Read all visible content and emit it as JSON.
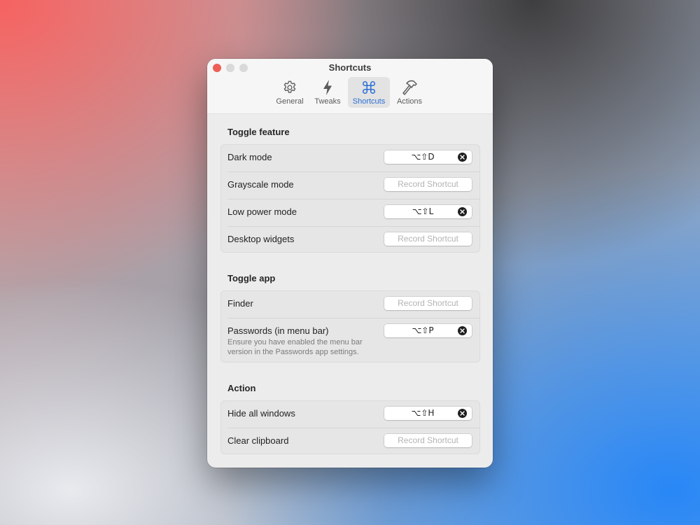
{
  "window": {
    "title": "Shortcuts"
  },
  "tabs": [
    {
      "label": "General",
      "icon": "gear-icon",
      "active": false
    },
    {
      "label": "Tweaks",
      "icon": "bolt-icon",
      "active": true
    },
    {
      "label": "Shortcuts",
      "icon": "command-icon",
      "active": true
    },
    {
      "label": "Actions",
      "icon": "hammer-icon",
      "active": false
    }
  ],
  "sections": [
    {
      "title": "Toggle feature",
      "rows": [
        {
          "label": "Dark mode",
          "shortcut": "⌥⇧D",
          "placeholder": "Record Shortcut"
        },
        {
          "label": "Grayscale mode",
          "shortcut": "",
          "placeholder": "Record Shortcut"
        },
        {
          "label": "Low power mode",
          "shortcut": "⌥⇧L",
          "placeholder": "Record Shortcut"
        },
        {
          "label": "Desktop widgets",
          "shortcut": "",
          "placeholder": "Record Shortcut"
        }
      ]
    },
    {
      "title": "Toggle app",
      "rows": [
        {
          "label": "Finder",
          "shortcut": "",
          "placeholder": "Record Shortcut"
        },
        {
          "label": "Passwords (in menu bar)",
          "sublabel": "Ensure you have enabled the menu bar version in the Passwords app settings.",
          "shortcut": "⌥⇧P",
          "placeholder": "Record Shortcut"
        }
      ]
    },
    {
      "title": "Action",
      "rows": [
        {
          "label": "Hide all windows",
          "shortcut": "⌥⇧H",
          "placeholder": "Record Shortcut"
        },
        {
          "label": "Clear clipboard",
          "shortcut": "",
          "placeholder": "Record Shortcut"
        }
      ]
    }
  ],
  "colors": {
    "accent": "#2c6fd6",
    "close": "#ee5f57"
  }
}
